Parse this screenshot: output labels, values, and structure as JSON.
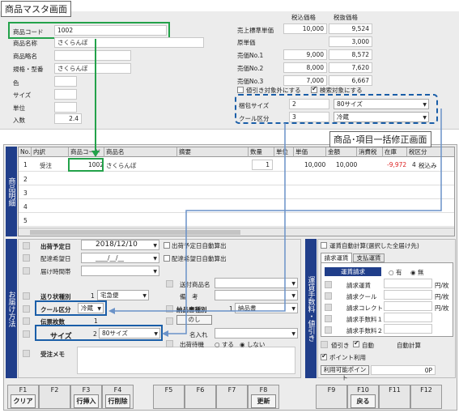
{
  "master": {
    "title": "商品マスタ画面",
    "code_label": "商品コード",
    "code": "1002",
    "name_label": "商品名称",
    "name": "さくらんぼ",
    "short_label": "商品略名",
    "spec_label": "規格・型番",
    "spec": "さくらんぼ",
    "color_label": "色",
    "size_label": "サイズ",
    "unit_label": "単位",
    "qty_label": "入数",
    "qty": "2.4",
    "price_col1": "税込価格",
    "price_col2": "税抜価格",
    "prices": [
      {
        "label": "売上標準単価",
        "incl": "10,000",
        "excl": "9,524"
      },
      {
        "label": "原単価",
        "incl": "",
        "excl": "3,000"
      },
      {
        "label": "売価No.1",
        "incl": "9,000",
        "excl": "8,572"
      },
      {
        "label": "売価No.2",
        "incl": "8,000",
        "excl": "7,620"
      },
      {
        "label": "売価No.3",
        "incl": "7,000",
        "excl": "6,667"
      }
    ],
    "exclude_discount": "値引き対象外にする",
    "search_target": "検索対象にする",
    "pack_size_label": "梱包サイズ",
    "pack_size_num": "2",
    "pack_size_val": "80サイズ",
    "cool_label": "クール区分",
    "cool_num": "3",
    "cool_val": "冷蔵"
  },
  "bulk": {
    "title": "商品･項目一括修正画面",
    "side_detail": "商品明細",
    "side_delivery": "お届け方法",
    "side_fee": "運賃手数料・値引き",
    "headers": [
      "No.",
      "内訳",
      "商品コード",
      "商品名",
      "摘要",
      "数量",
      "単位",
      "単価",
      "金額",
      "消費税",
      "在庫",
      "税区分"
    ],
    "row": {
      "no": "1",
      "type": "受注",
      "code": "1002",
      "name": "さくらんぼ",
      "qty": "1",
      "price": "10,000",
      "amount": "10,000",
      "stock": "-9,972",
      "tax_num": "4",
      "tax": "税込み"
    },
    "row_nums": [
      "2",
      "3",
      "4",
      "5"
    ],
    "ship_date_label": "出荷予定日",
    "ship_date": "2018/12/10",
    "ship_auto": "出荷予定日自動算出",
    "deliv_date_label": "配達希望日",
    "deliv_date": "____/__/__",
    "deliv_auto": "配達希望日自動算出",
    "time_label": "届け時間帯",
    "send_type_label": "送り状種別",
    "send_type_num": "1",
    "send_type": "宅急便",
    "cool_label": "クール区分",
    "cool": "冷蔵",
    "slip_label": "伝票枚数",
    "slip": "1",
    "size_label": "サイズ",
    "size_num": "2",
    "size": "80サイズ",
    "memo_label": "受注メモ",
    "dest_label": "送付商品名",
    "note_label": "備　考",
    "invoice_label": "納品書種別",
    "invoice_num": "1",
    "invoice": "納品書",
    "noshi": "のし",
    "nairi_label": "名入れ",
    "hold_label": "出荷待機",
    "hold_yes": "する",
    "hold_no": "しない",
    "fee_auto": "運賃自動計算(選択した全届け先)",
    "tab1": "請求運賃",
    "tab2": "支払運賃",
    "tax_req": "運賃請求",
    "yes": "有",
    "no": "無",
    "fees": [
      "請求運賃",
      "請求クール",
      "請求コレクト",
      "請求手数料１",
      "請求手数料２"
    ],
    "fee_unit": "円/枚",
    "discount_label": "値引き",
    "auto": "自動",
    "auto_calc": "自動計算",
    "point_use": "ポイント利用",
    "point_avail": "利用可能ポイント",
    "point_val": "0P"
  },
  "fkeys": [
    {
      "n": "F1",
      "b": "クリア"
    },
    {
      "n": "F2",
      "b": ""
    },
    {
      "n": "F3",
      "b": "行挿入"
    },
    {
      "n": "F4",
      "b": "行削除"
    },
    {
      "n": "F5",
      "b": ""
    },
    {
      "n": "F6",
      "b": ""
    },
    {
      "n": "F7",
      "b": ""
    },
    {
      "n": "F8",
      "b": "更新"
    },
    {
      "n": "F9",
      "b": ""
    },
    {
      "n": "F10",
      "b": "戻る"
    },
    {
      "n": "F11",
      "b": ""
    },
    {
      "n": "F12",
      "b": ""
    }
  ]
}
